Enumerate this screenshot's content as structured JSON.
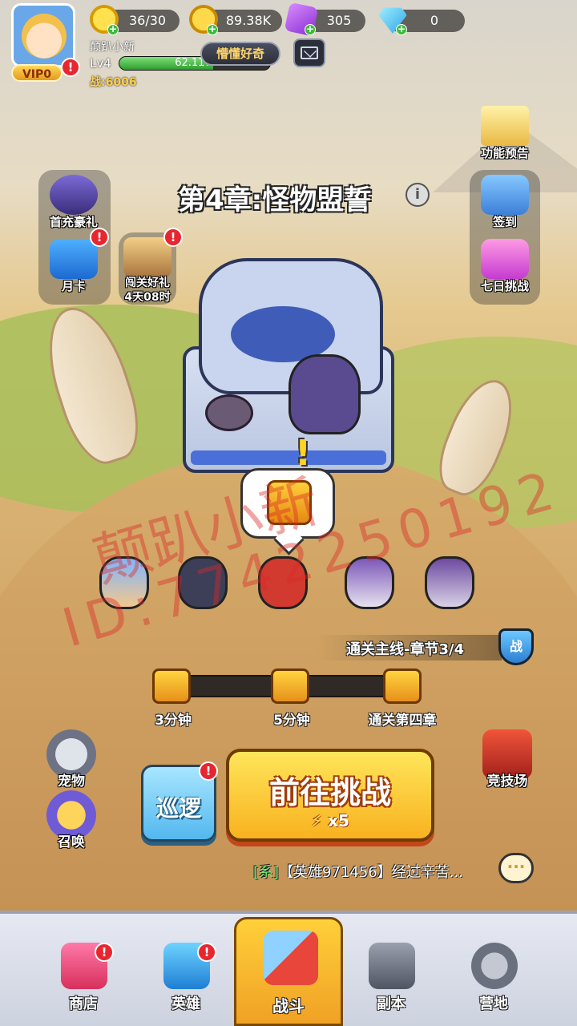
{
  "player": {
    "vip_label": "VIP0",
    "name": "颠趴小新",
    "level": "Lv4",
    "xp_percent_text": "62.11%",
    "xp_fraction": 0.6211,
    "power": "战:6006",
    "title_badge": "懵懂好奇"
  },
  "resources": {
    "stamina": "36/30",
    "gold": "89.38K",
    "gems_purple": "305",
    "diamonds": "0"
  },
  "side_left": {
    "first_recharge": "首充豪礼",
    "month_card": "月卡",
    "stage_gift": "闯关好礼",
    "stage_gift_timer": "4天08时"
  },
  "side_right": {
    "feature_preview": "功能预告",
    "checkin": "签到",
    "seven_day": "七日挑战"
  },
  "chapter": {
    "title": "第4章:怪物盟誓",
    "info_icon": "i"
  },
  "watermark": {
    "line1": "颠趴小新",
    "line2": "ID:7742250192"
  },
  "progress": {
    "label": "通关主线-章节3/4",
    "shield": "战",
    "rewards": [
      {
        "label": "3分钟"
      },
      {
        "label": "5分钟"
      },
      {
        "label": "通关第四章"
      }
    ]
  },
  "actions": {
    "pet": "宠物",
    "summon": "召唤",
    "arena": "竞技场",
    "patrol": "巡逻",
    "challenge": "前往挑战",
    "challenge_cost": "x5"
  },
  "chat": {
    "tag": "[系]",
    "message": "【英雄971456】经过辛苦..."
  },
  "nav": {
    "shop": "商店",
    "heroes": "英雄",
    "battle": "战斗",
    "dungeon": "副本",
    "camp": "营地"
  },
  "colors": {
    "accent_gold": "#f8b21f",
    "alert_red": "#e8262f",
    "patrol_blue": "#53b8ee"
  }
}
